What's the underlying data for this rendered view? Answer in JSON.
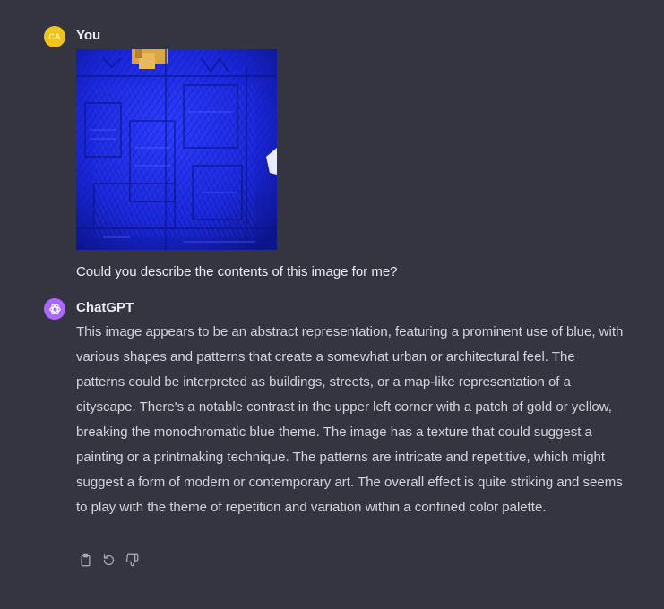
{
  "user": {
    "initials": "CA",
    "name": "You",
    "message": "Could you describe the contents of this image for me?",
    "avatar_color": "#f0c419"
  },
  "assistant": {
    "name": "ChatGPT",
    "avatar_color": "#ab68ff",
    "message": "This image appears to be an abstract representation, featuring a prominent use of blue, with various shapes and patterns that create a somewhat urban or architectural feel. The patterns could be interpreted as buildings, streets, or a map-like representation of a cityscape. There's a notable contrast in the upper left corner with a patch of gold or yellow, breaking the monochromatic blue theme. The image has a texture that could suggest a painting or a printmaking technique. The patterns are intricate and repetitive, which might suggest a form of modern or contemporary art. The overall effect is quite striking and seems to play with the theme of repetition and variation within a confined color palette.",
    "actions": [
      {
        "icon": "clipboard-icon"
      },
      {
        "icon": "regenerate-icon"
      },
      {
        "icon": "thumbs-down-icon"
      }
    ]
  },
  "colors": {
    "background": "#343541",
    "image_blue": "#1a2bd6"
  }
}
